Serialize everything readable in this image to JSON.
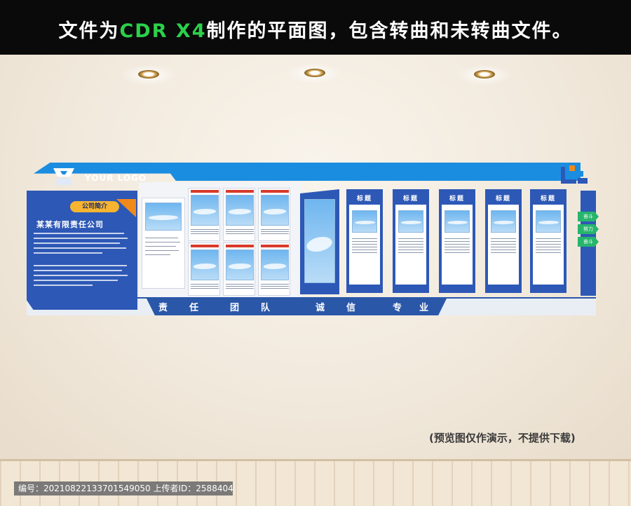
{
  "header": {
    "caption_prefix": "文件为",
    "caption_highlight": "CDR X4",
    "caption_suffix": "制作的平面图，包含转曲和未转曲文件。"
  },
  "board": {
    "logo_text": "YOUR LOGO",
    "intro_tag": "公司简介",
    "company_name": "某某有限责任公司",
    "card_titles": [
      "标题",
      "标题",
      "标题",
      "标题",
      "标题"
    ],
    "slogans": [
      "责",
      "任",
      "团",
      "队",
      "诚",
      "信",
      "专",
      "业"
    ],
    "side_chips": [
      "奋斗",
      "努力",
      "奋斗"
    ]
  },
  "footer": {
    "note": "(预览图仅作演示，不提供下载)",
    "meta": "编号：20210822133701549050 上传者ID：2588404"
  },
  "colors": {
    "brand_blue": "#2d58b6",
    "sky_blue": "#1a8de0",
    "accent_orange": "#f08a1a",
    "accent_green": "#2bd14a"
  }
}
